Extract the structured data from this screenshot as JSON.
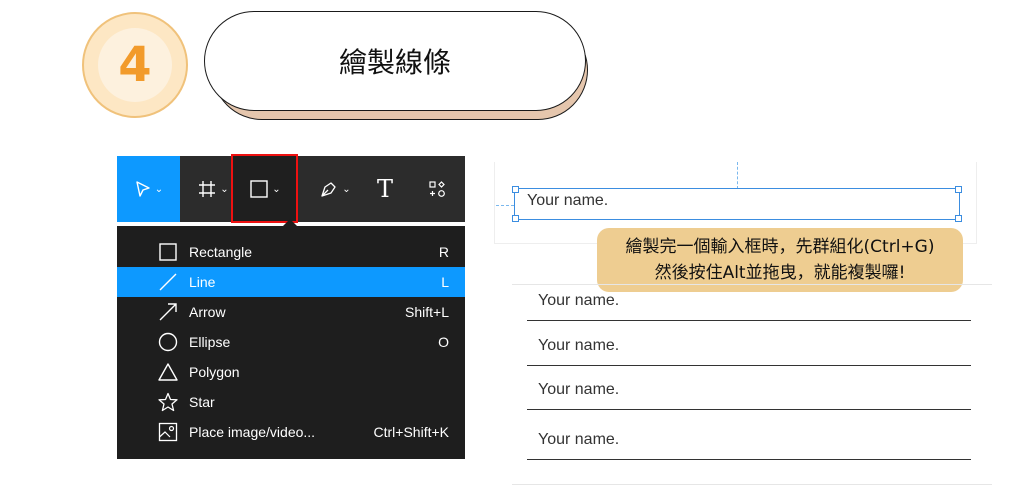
{
  "step": {
    "number": "4",
    "title": "繪製線條"
  },
  "toolbar": {
    "tools": [
      {
        "name": "move-tool",
        "icon": "cursor-icon"
      },
      {
        "name": "frame-tool",
        "icon": "frame-hash-icon"
      },
      {
        "name": "shape-tool",
        "icon": "rectangle-icon",
        "selected": true
      },
      {
        "name": "pen-tool",
        "icon": "pen-icon"
      },
      {
        "name": "text-tool",
        "label": "T"
      },
      {
        "name": "resources-tool",
        "icon": "components-icon"
      }
    ]
  },
  "menu": {
    "items": [
      {
        "label": "Rectangle",
        "shortcut": "R",
        "icon": "rectangle-icon"
      },
      {
        "label": "Line",
        "shortcut": "L",
        "icon": "line-icon",
        "active": true
      },
      {
        "label": "Arrow",
        "shortcut": "Shift+L",
        "icon": "arrow-icon"
      },
      {
        "label": "Ellipse",
        "shortcut": "O",
        "icon": "ellipse-icon"
      },
      {
        "label": "Polygon",
        "shortcut": "",
        "icon": "polygon-icon"
      },
      {
        "label": "Star",
        "shortcut": "",
        "icon": "star-icon"
      },
      {
        "label": "Place image/video...",
        "shortcut": "Ctrl+Shift+K",
        "icon": "image-icon"
      }
    ]
  },
  "canvas": {
    "selected_field": "Your name.",
    "tip_line1": "繪製完一個輸入框時，先群組化(Ctrl+G)",
    "tip_line2": "然後按住Alt並拖曳，就能複製囉!",
    "fields": [
      "Your name.",
      "Your name.",
      "Your name.",
      "Your name."
    ]
  },
  "colors": {
    "accent": "#0d99ff",
    "highlight": "#e11111",
    "badge": "#f29b2b",
    "tip": "#eecd91"
  }
}
